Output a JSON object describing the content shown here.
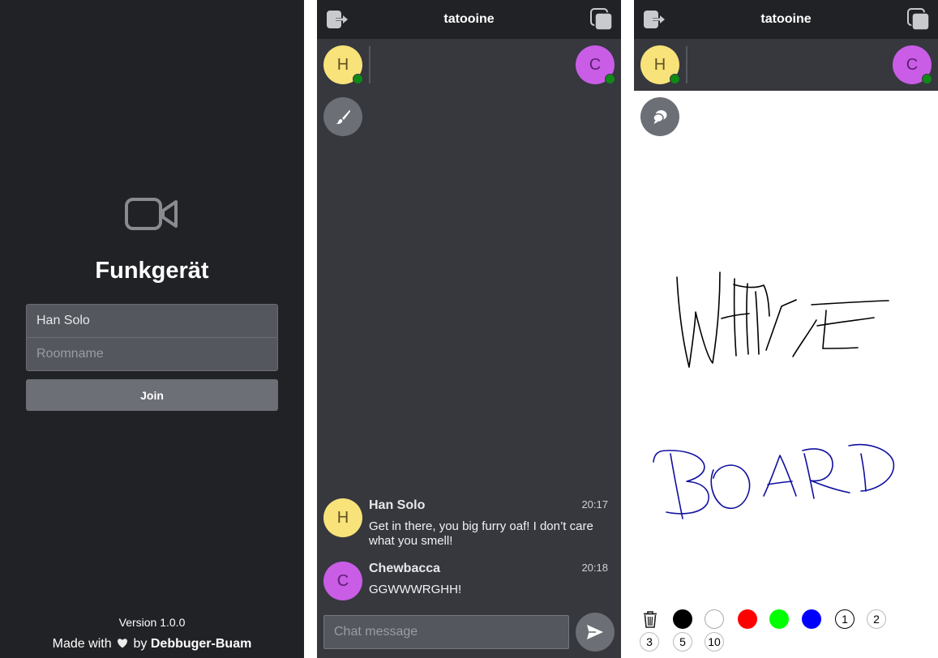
{
  "login": {
    "app_title": "Funkgerät",
    "username_value": "Han Solo",
    "room_placeholder": "Roomname",
    "join_label": "Join",
    "version": "Version 1.0.0",
    "made_with_prefix": "Made with",
    "made_with_by": "by",
    "author": "Debbuger-Buam",
    "icon": "video-camera-icon"
  },
  "chat_view": {
    "room_name": "tatooine",
    "users": [
      {
        "initial": "H",
        "color": "#f8e27a",
        "status": "online"
      },
      {
        "initial": "C",
        "color": "#c95de6",
        "status": "online"
      }
    ],
    "toggle_icon": "paintbrush-icon",
    "messages": [
      {
        "initial": "H",
        "sender": "Han Solo",
        "time": "20:17",
        "text": "Get in there, you big furry oaf! I don’t care what you smell!"
      },
      {
        "initial": "C",
        "sender": "Chewbacca",
        "time": "20:18",
        "text": "GGWWWRGHH!"
      }
    ],
    "input_placeholder": "Chat message",
    "send_icon": "send-icon"
  },
  "board_view": {
    "room_name": "tatooine",
    "users": [
      {
        "initial": "H",
        "color": "#f8e27a",
        "status": "online"
      },
      {
        "initial": "C",
        "color": "#c95de6",
        "status": "online"
      }
    ],
    "toggle_icon": "chat-bubble-icon",
    "drawing_words": [
      "WHITE",
      "BOARD"
    ],
    "palette": [
      "#000000",
      "#ffffff",
      "#ff0000",
      "#00ff00",
      "#0000ff"
    ],
    "sizes": [
      "1",
      "2",
      "3",
      "5",
      "10"
    ],
    "selected_size": "1",
    "trash_icon": "trash-icon"
  }
}
